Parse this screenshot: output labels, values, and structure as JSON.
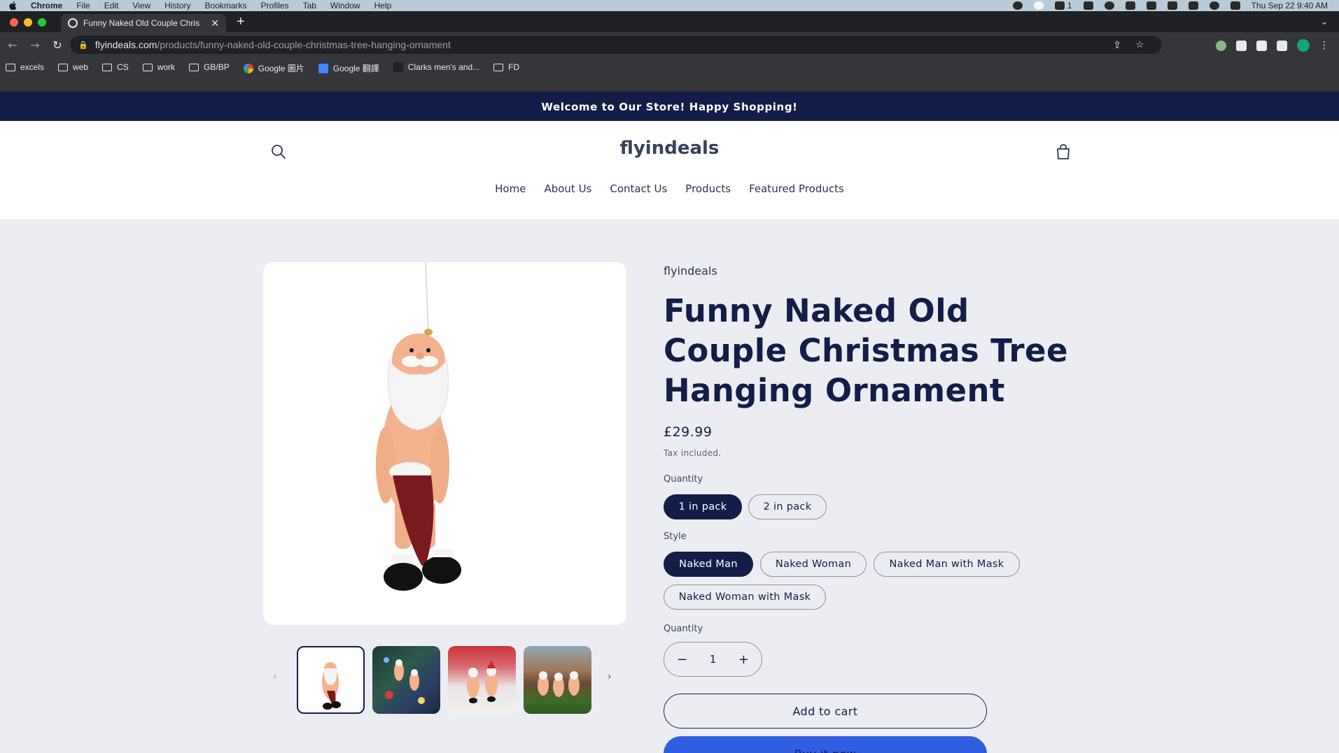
{
  "macos_menubar": {
    "app_name": "Chrome",
    "menus": [
      "File",
      "Edit",
      "View",
      "History",
      "Bookmarks",
      "Profiles",
      "Tab",
      "Window",
      "Help"
    ],
    "notification_count": "1",
    "datetime": "Thu Sep 22  9:40 AM"
  },
  "browser": {
    "tab_title": "Funny Naked Old Couple Chris",
    "url_domain": "flyindeals.com",
    "url_path": "/products/funny-naked-old-couple-christmas-tree-hanging-ornament",
    "bookmarks": [
      {
        "label": "excels",
        "icon": "folder-icon"
      },
      {
        "label": "web",
        "icon": "folder-icon"
      },
      {
        "label": "CS",
        "icon": "folder-icon"
      },
      {
        "label": "work",
        "icon": "folder-icon"
      },
      {
        "label": "GB/BP",
        "icon": "folder-icon"
      },
      {
        "label": "Google 圖片",
        "icon": "google-icon"
      },
      {
        "label": "Google 翻譯",
        "icon": "google-translate-icon"
      },
      {
        "label": "Clarks men's and...",
        "icon": "clarks-icon"
      },
      {
        "label": "FD",
        "icon": "folder-icon"
      }
    ]
  },
  "store": {
    "announcement": "Welcome to Our Store! Happy Shopping!",
    "logo": "flyindeals",
    "nav": [
      "Home",
      "About Us",
      "Contact Us",
      "Products",
      "Featured Products"
    ]
  },
  "product": {
    "vendor": "flyindeals",
    "title": "Funny Naked Old Couple Christmas Tree Hanging Ornament",
    "price": "£29.99",
    "tax_note": "Tax included.",
    "quantity_option": {
      "label": "Quantity",
      "values": [
        "1 in pack",
        "2 in pack"
      ],
      "selected": "1 in pack"
    },
    "style_option": {
      "label": "Style",
      "values": [
        "Naked Man",
        "Naked Woman",
        "Naked Man with Mask",
        "Naked Woman with Mask"
      ],
      "selected": "Naked Man"
    },
    "quantity_selector": {
      "label": "Quantity",
      "value": "1",
      "decrement": "−",
      "increment": "+"
    },
    "add_to_cart": "Add to cart",
    "buy_now": "Buy it now",
    "thumbnail_count": 4,
    "active_thumbnail": 1,
    "prev_arrow": "‹",
    "next_arrow": "›"
  },
  "colors": {
    "brand_navy": "#121e48",
    "announcement_bg": "#121e48",
    "page_bg": "#ecedf2",
    "buy_button": "#2f5ee0"
  }
}
